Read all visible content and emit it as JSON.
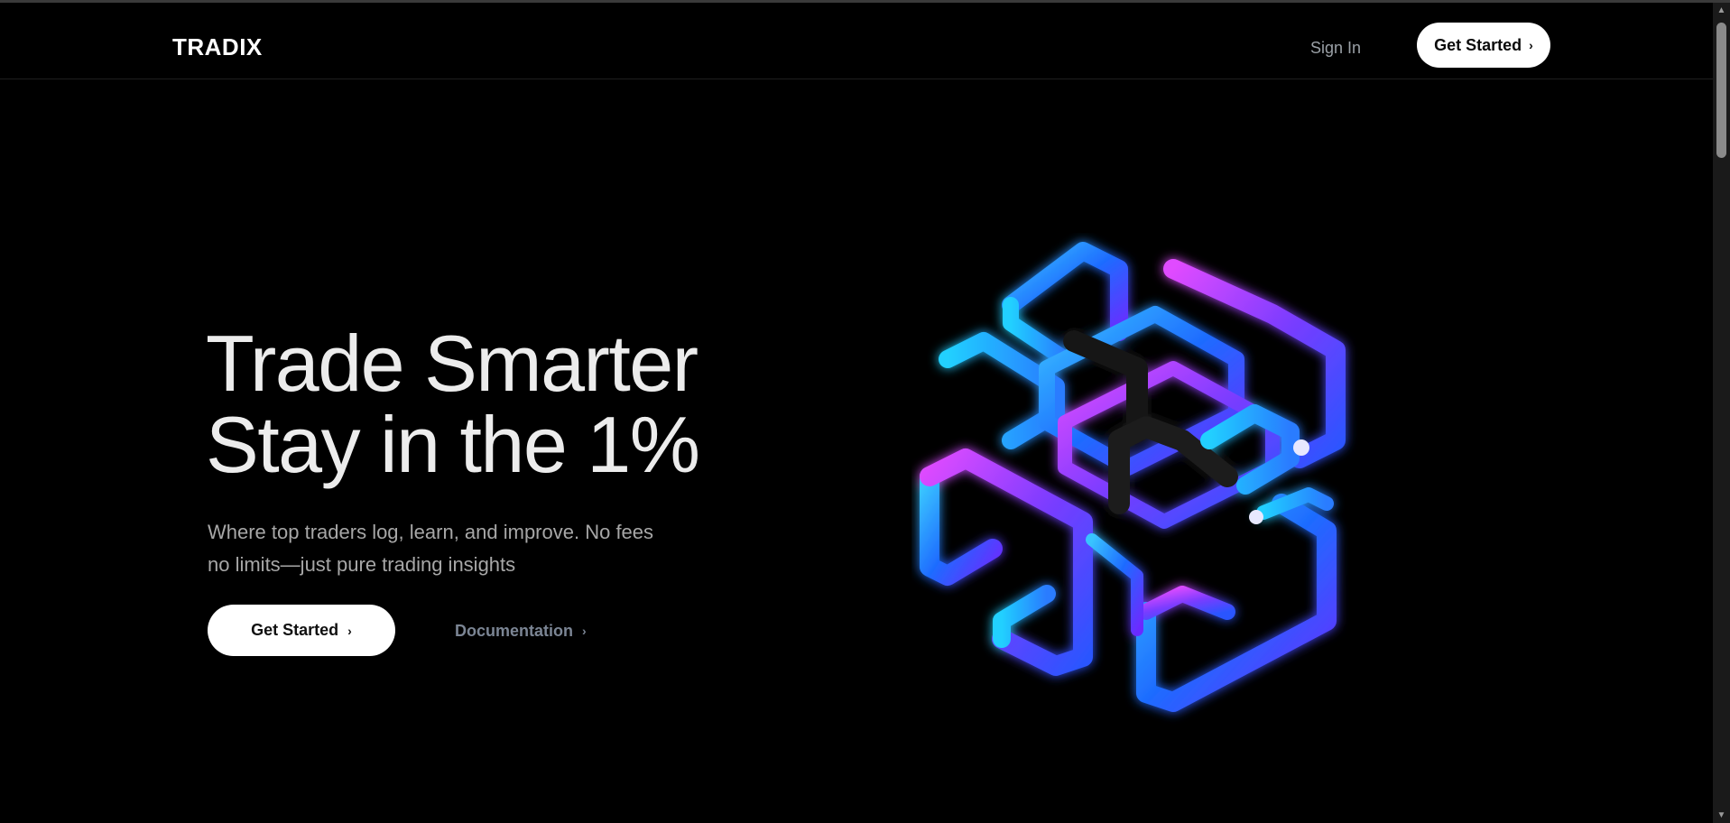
{
  "nav": {
    "logo": "TRADIX",
    "sign_in": "Sign In",
    "cta_label": "Get Started",
    "cta_icon": "chevron-right-icon"
  },
  "hero": {
    "headline_line1": "Trade Smarter",
    "headline_line2": "Stay in the 1%",
    "subtext_line1": "Where top traders log, learn, and improve. No fees",
    "subtext_line2": "no limits—just pure trading insights",
    "primary_cta": "Get Started",
    "secondary_cta": "Documentation",
    "art": "glowing-3d-tube-lattice"
  },
  "colors": {
    "background": "#000000",
    "text_primary": "#ececec",
    "text_secondary": "#a7a7a7",
    "muted_link": "#7b8594",
    "button_bg": "#ffffff",
    "accent_blue": "#1e8bff",
    "accent_purple": "#8a2be2",
    "accent_magenta": "#d03cff"
  },
  "chevron_glyph": "›"
}
